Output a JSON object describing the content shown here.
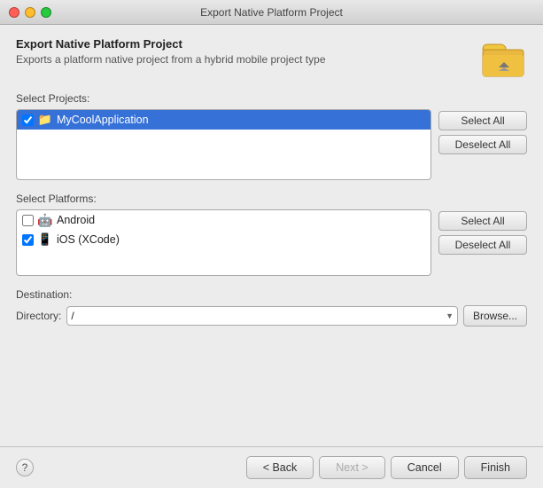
{
  "window": {
    "title": "Export Native Platform Project"
  },
  "header": {
    "title": "Export Native Platform Project",
    "subtitle": "Exports a platform native project from a hybrid mobile project type"
  },
  "projects_section": {
    "label": "Select Projects:",
    "items": [
      {
        "name": "MyCoolApplication",
        "checked": true,
        "icon": "project"
      }
    ],
    "select_all_label": "Select All",
    "deselect_all_label": "Deselect All"
  },
  "platforms_section": {
    "label": "Select Platforms:",
    "items": [
      {
        "name": "Android",
        "checked": false,
        "icon": "android"
      },
      {
        "name": "iOS (XCode)",
        "checked": true,
        "icon": "ios"
      }
    ],
    "select_all_label": "Select All",
    "deselect_all_label": "Deselect All"
  },
  "destination_section": {
    "label": "Destination:",
    "directory_label": "Directory:",
    "directory_value": "/",
    "browse_label": "Browse..."
  },
  "bottom_bar": {
    "help_label": "?",
    "back_label": "< Back",
    "next_label": "Next >",
    "cancel_label": "Cancel",
    "finish_label": "Finish"
  }
}
